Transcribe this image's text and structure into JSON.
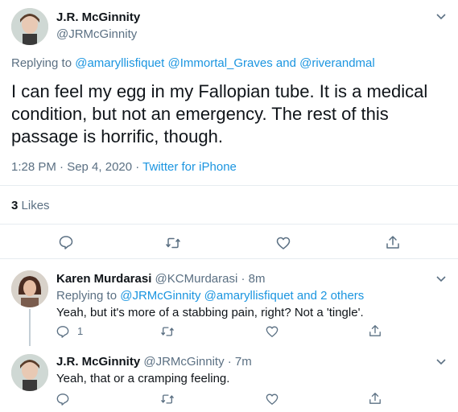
{
  "main_tweet": {
    "name": "J.R. McGinnity",
    "handle": "@JRMcGinnity",
    "replying_prefix": "Replying to",
    "replying_users": [
      "@amaryllisfiquet",
      "@Immortal_Graves",
      "and",
      "@riverandmal"
    ],
    "text": "I can feel my egg in my Fallopian tube. It is a medical condition, but not an emergency. The rest of this passage is horrific, though.",
    "time": "1:28 PM · Sep 4, 2020 · ",
    "source": "Twitter for iPhone",
    "likes_count": "3",
    "likes_label": "Likes"
  },
  "replies": [
    {
      "name": "Karen Murdarasi",
      "handle_time": "@KCMurdarasi · 8m",
      "replying_prefix": "Replying to",
      "replying_users": "@JRMcGinnity @amaryllisfiquet and 2 others",
      "text": "Yeah, but it's more of a stabbing pain, right? Not a 'tingle'.",
      "reply_count": "1"
    },
    {
      "name": "J.R. McGinnity",
      "handle_time": "@JRMcGinnity · 7m",
      "text": "Yeah, that or a cramping feeling."
    }
  ],
  "colors": {
    "link": "#1b95e0",
    "grey": "#5b7083",
    "divider": "#e6ecf0"
  },
  "icons": [
    "chevron-down-icon",
    "reply-icon",
    "retweet-icon",
    "like-icon",
    "share-icon"
  ]
}
